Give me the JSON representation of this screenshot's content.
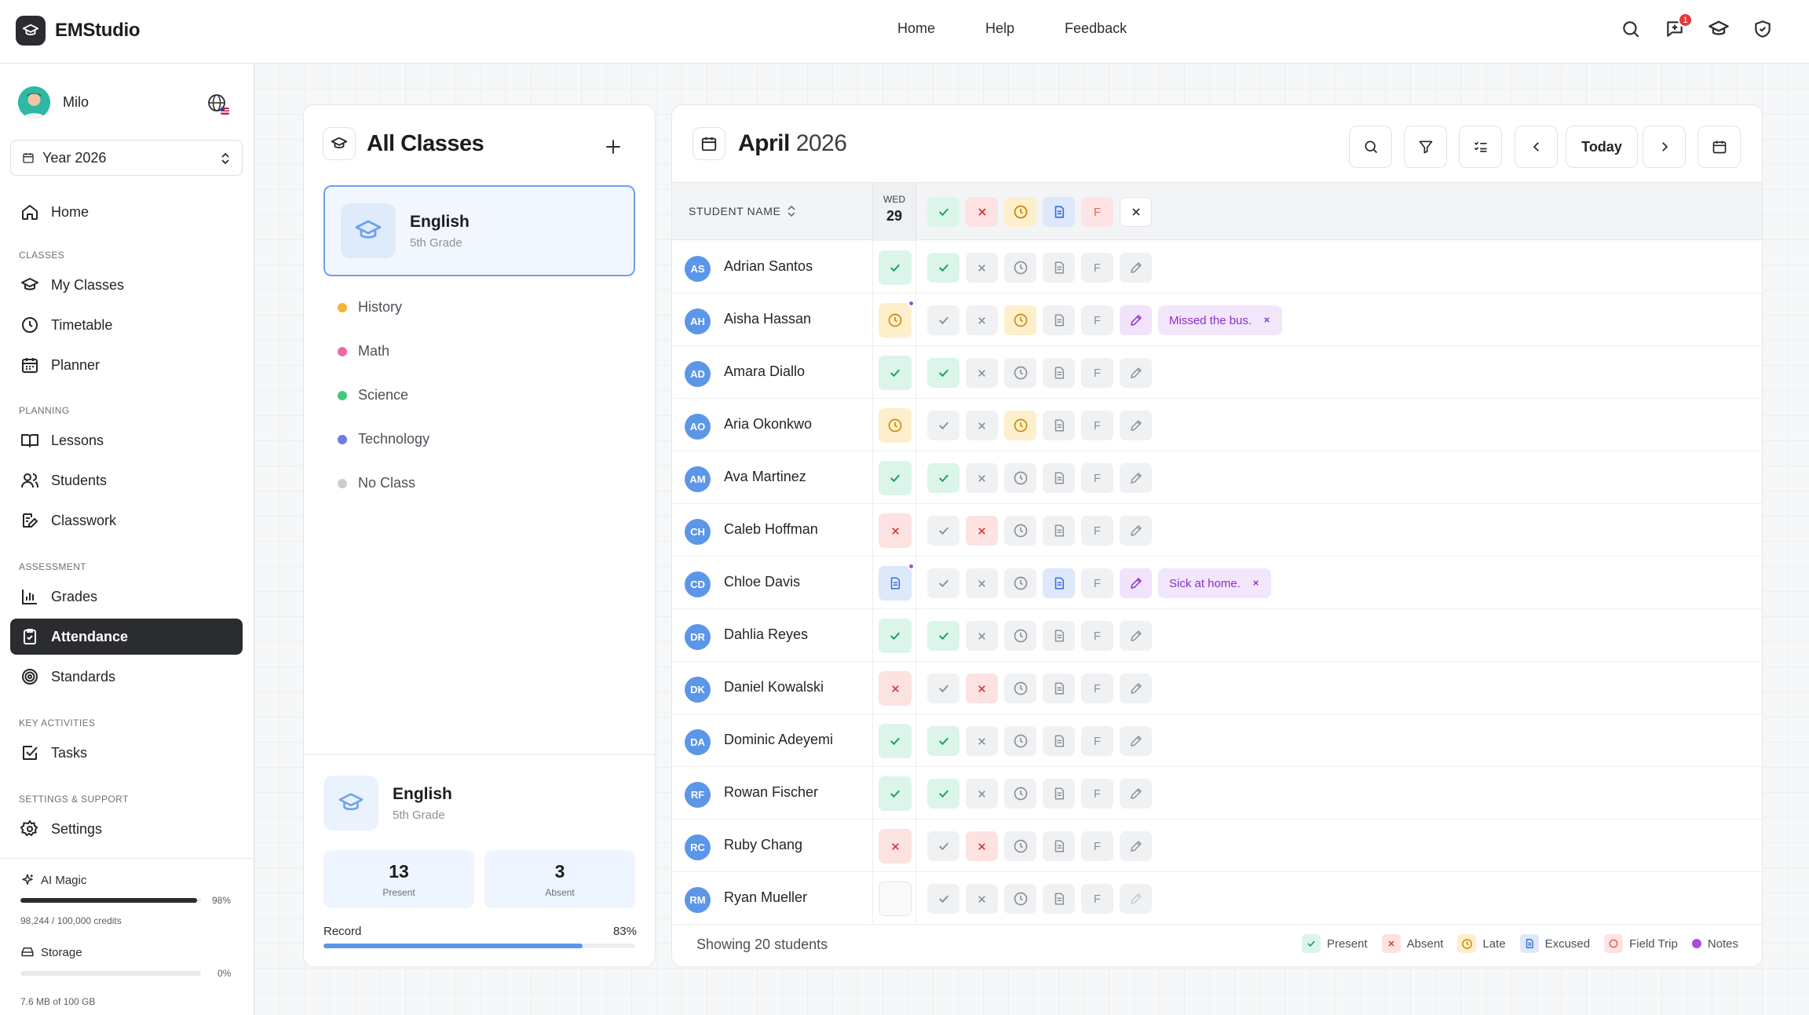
{
  "brand": {
    "name": "EMStudio"
  },
  "topnav": [
    "Home",
    "Help",
    "Feedback"
  ],
  "notifications": {
    "count": "1"
  },
  "user": {
    "name": "Milo"
  },
  "year_select": {
    "value": "Year 2026"
  },
  "sidebar": {
    "home": "Home",
    "sections": {
      "classes": "CLASSES",
      "planning": "PLANNING",
      "assessment": "ASSESSMENT",
      "key_activities": "KEY ACTIVITIES",
      "settings_support": "SETTINGS & SUPPORT"
    },
    "items": {
      "my_classes": "My Classes",
      "timetable": "Timetable",
      "planner": "Planner",
      "lessons": "Lessons",
      "students": "Students",
      "classwork": "Classwork",
      "grades": "Grades",
      "attendance": "Attendance",
      "standards": "Standards",
      "tasks": "Tasks",
      "settings": "Settings"
    },
    "ai_magic": {
      "label": "AI Magic",
      "percent": "98%",
      "fill": 0.98,
      "credits": "98,244 / 100,000 credits"
    },
    "storage": {
      "label": "Storage",
      "percent": "0%",
      "fill": 0.0,
      "usage": "7.6 MB of 100 GB"
    }
  },
  "classes_panel": {
    "title": "All Classes",
    "selected": {
      "name": "English",
      "grade": "5th Grade"
    },
    "list": [
      {
        "name": "History",
        "color": "#f2b632"
      },
      {
        "name": "Math",
        "color": "#ee6aa6"
      },
      {
        "name": "Science",
        "color": "#3fcb7c"
      },
      {
        "name": "Technology",
        "color": "#6b7ee8"
      },
      {
        "name": "No Class",
        "color": "#c9ccd1"
      }
    ],
    "summary": {
      "name": "English",
      "grade": "5th Grade",
      "present": "13",
      "present_label": "Present",
      "absent": "3",
      "absent_label": "Absent",
      "record_label": "Record",
      "record_pct": "83%",
      "record_fill": 0.83
    }
  },
  "attendance": {
    "month": "April",
    "year": "2026",
    "today_label": "Today",
    "column_header": "STUDENT NAME",
    "day": {
      "weekday": "WED",
      "num": "29"
    },
    "rows": [
      {
        "initials": "AS",
        "name": "Adrian Santos",
        "status": "present",
        "note": ""
      },
      {
        "initials": "AH",
        "name": "Aisha Hassan",
        "status": "late",
        "note": "Missed the bus."
      },
      {
        "initials": "AD",
        "name": "Amara Diallo",
        "status": "present",
        "note": ""
      },
      {
        "initials": "AO",
        "name": "Aria Okonkwo",
        "status": "late",
        "note": ""
      },
      {
        "initials": "AM",
        "name": "Ava Martinez",
        "status": "present",
        "note": ""
      },
      {
        "initials": "CH",
        "name": "Caleb Hoffman",
        "status": "absent",
        "note": ""
      },
      {
        "initials": "CD",
        "name": "Chloe Davis",
        "status": "excused",
        "note": "Sick at home."
      },
      {
        "initials": "DR",
        "name": "Dahlia Reyes",
        "status": "present",
        "note": ""
      },
      {
        "initials": "DK",
        "name": "Daniel Kowalski",
        "status": "absent",
        "note": ""
      },
      {
        "initials": "DA",
        "name": "Dominic Adeyemi",
        "status": "present",
        "note": ""
      },
      {
        "initials": "RF",
        "name": "Rowan Fischer",
        "status": "present",
        "note": ""
      },
      {
        "initials": "RC",
        "name": "Ruby Chang",
        "status": "absent",
        "note": ""
      },
      {
        "initials": "RM",
        "name": "Ryan Mueller",
        "status": "none",
        "note": ""
      }
    ],
    "field_trip_letter": "F",
    "footer": {
      "showing": "Showing 20 students"
    },
    "legend": [
      "Present",
      "Absent",
      "Late",
      "Excused",
      "Field Trip",
      "Notes"
    ]
  }
}
